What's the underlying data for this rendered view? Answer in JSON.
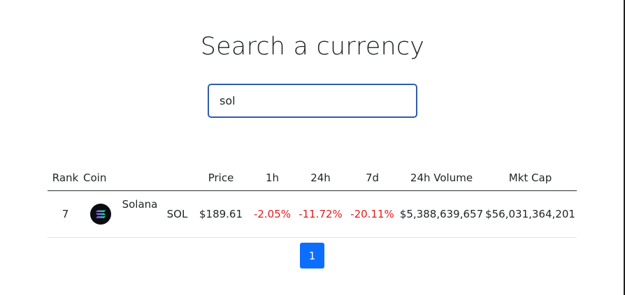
{
  "header": {
    "title": "Search a currency"
  },
  "search": {
    "value": "sol",
    "placeholder": ""
  },
  "table": {
    "columns": [
      "Rank",
      "Coin",
      "",
      "",
      "Price",
      "1h",
      "24h",
      "7d",
      "24h Volume",
      "Mkt Cap"
    ],
    "rows": [
      {
        "rank": "7",
        "icon": "solana-logo-icon",
        "name": "Solana",
        "symbol": "SOL",
        "price": "$189.61",
        "change_1h": "-2.05%",
        "change_24h": "-11.72%",
        "change_7d": "-20.11%",
        "volume_24h": "$5,388,639,657",
        "market_cap": "$56,031,364,201"
      }
    ]
  },
  "pagination": {
    "pages": [
      "1"
    ],
    "active": "1"
  },
  "colors": {
    "negative": "#e01b1b",
    "accent": "#0d6efd",
    "input_border": "#2f5da8"
  }
}
